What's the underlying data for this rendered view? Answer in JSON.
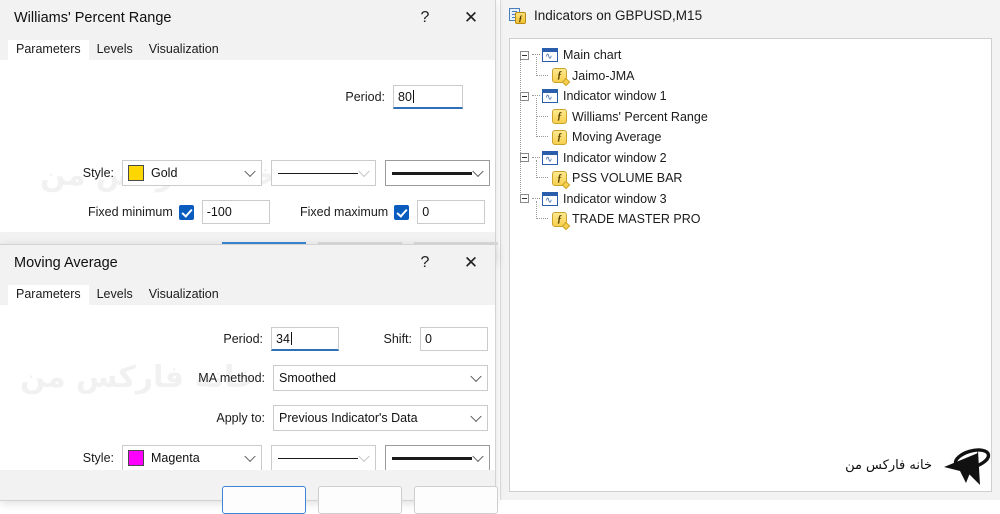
{
  "indicators_window": {
    "title": "Indicators on GBPUSD,M15",
    "icon": "indicators-list-icon",
    "tree": [
      {
        "label": "Main chart",
        "type": "window",
        "icon": "chart-window-icon",
        "indent": 0
      },
      {
        "label": "Jaimo-JMA",
        "type": "indicator",
        "icon": "custom-indicator-icon",
        "indent": 1
      },
      {
        "label": "Indicator window 1",
        "type": "window",
        "icon": "chart-window-icon",
        "indent": 0
      },
      {
        "label": "Williams' Percent Range",
        "type": "indicator",
        "icon": "indicator-icon",
        "indent": 1
      },
      {
        "label": "Moving Average",
        "type": "indicator",
        "icon": "indicator-icon",
        "indent": 1
      },
      {
        "label": "Indicator window 2",
        "type": "window",
        "icon": "chart-window-icon",
        "indent": 0
      },
      {
        "label": "PSS VOLUME BAR",
        "type": "indicator",
        "icon": "custom-indicator-icon",
        "indent": 1
      },
      {
        "label": "Indicator window 3",
        "type": "window",
        "icon": "chart-window-icon",
        "indent": 0
      },
      {
        "label": "TRADE MASTER PRO",
        "type": "indicator",
        "icon": "custom-indicator-icon",
        "indent": 1
      }
    ]
  },
  "wpr_dialog": {
    "title": "Williams' Percent Range",
    "help_label": "?",
    "close_label": "✕",
    "tabs": [
      {
        "label": "Parameters",
        "active": true
      },
      {
        "label": "Levels",
        "active": false
      },
      {
        "label": "Visualization",
        "active": false
      }
    ],
    "period_label": "Period:",
    "period_value": "80",
    "style_label": "Style:",
    "style_color_name": "Gold",
    "style_color_hex": "#FFD700",
    "fixed_minimum_label": "Fixed minimum",
    "fixed_minimum_value": "-100",
    "fixed_minimum_checked": true,
    "fixed_maximum_label": "Fixed maximum",
    "fixed_maximum_value": "0",
    "fixed_maximum_checked": true
  },
  "ma_dialog": {
    "title": "Moving Average",
    "help_label": "?",
    "close_label": "✕",
    "tabs": [
      {
        "label": "Parameters",
        "active": true
      },
      {
        "label": "Levels",
        "active": false
      },
      {
        "label": "Visualization",
        "active": false
      }
    ],
    "period_label": "Period:",
    "period_value": "34",
    "shift_label": "Shift:",
    "shift_value": "0",
    "ma_method_label": "MA method:",
    "ma_method_value": "Smoothed",
    "apply_to_label": "Apply to:",
    "apply_to_value": "Previous Indicator's Data",
    "style_label": "Style:",
    "style_color_name": "Magenta",
    "style_color_hex": "#FF00FF"
  },
  "watermark": {
    "text": "خانه فارکس من"
  },
  "logo": {
    "text": "خانه فارکس من",
    "icon": "rocket-orbit-logo-icon"
  }
}
